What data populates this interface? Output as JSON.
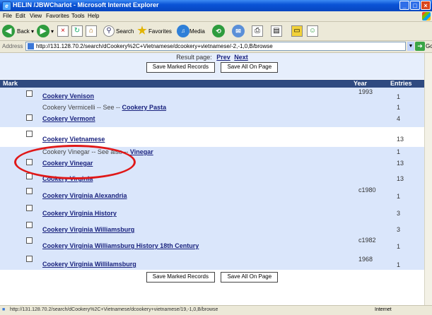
{
  "window": {
    "title": "HELIN /JBWCharlot - Microsoft Internet Explorer"
  },
  "menu": [
    "File",
    "Edit",
    "View",
    "Favorites",
    "Tools",
    "Help"
  ],
  "toolbar": {
    "back": "Back",
    "search": "Search",
    "favorites": "Favorites",
    "media": "Media"
  },
  "address": {
    "label": "Address",
    "url": "http://131.128.70.2/search/dCookery%2C+Vietnamese/dcookery+vietnamese/-2,-1,0,B/browse",
    "go": "Go"
  },
  "page": {
    "result_label": "Result page:",
    "prev": "Prev",
    "next": "Next",
    "save_marked": "Save Marked Records",
    "save_all": "Save All On Page",
    "headers": {
      "mark": "Mark",
      "year": "Year",
      "entries": "Entries"
    },
    "rows": [
      {
        "title": "Cookery Venison",
        "year": "1993",
        "entries": "1",
        "checkbox": true
      },
      {
        "see": "Cookery Vermicelli -- See --",
        "link": "Cookery Pasta",
        "entries": "1"
      },
      {
        "title": "Cookery Vermont",
        "entries": "4",
        "checkbox": true
      },
      {
        "title": "Cookery Vietnamese",
        "entries": "13",
        "checkbox": true
      },
      {
        "see": "Cookery Vinegar -- See also --",
        "link": "Vinegar",
        "entries": "1"
      },
      {
        "title": "Cookery Vinegar",
        "entries": "13",
        "checkbox": true
      },
      {
        "title": "Cookery Virginia",
        "entries": "13",
        "checkbox": true
      },
      {
        "title": "Cookery Virginia Alexandria",
        "year": "c1980",
        "entries": "1",
        "checkbox": true
      },
      {
        "title": "Cookery Virginia History",
        "entries": "3",
        "checkbox": true
      },
      {
        "title": "Cookery Virginia Williamsburg",
        "entries": "3",
        "checkbox": true
      },
      {
        "title": "Cookery Virginia Williamsburg History 18th Century",
        "year": "c1982",
        "entries": "1",
        "checkbox": true
      },
      {
        "title": "Cookery Virginia Willilamsburg",
        "year": "1968",
        "entries": "1",
        "checkbox": true
      }
    ]
  },
  "status": {
    "url": "http://131.128.70.2/search/dCookery%2C+Vietnamese/dcookery+vietnamese/19,-1,0,B/browse",
    "zone": "Internet"
  }
}
